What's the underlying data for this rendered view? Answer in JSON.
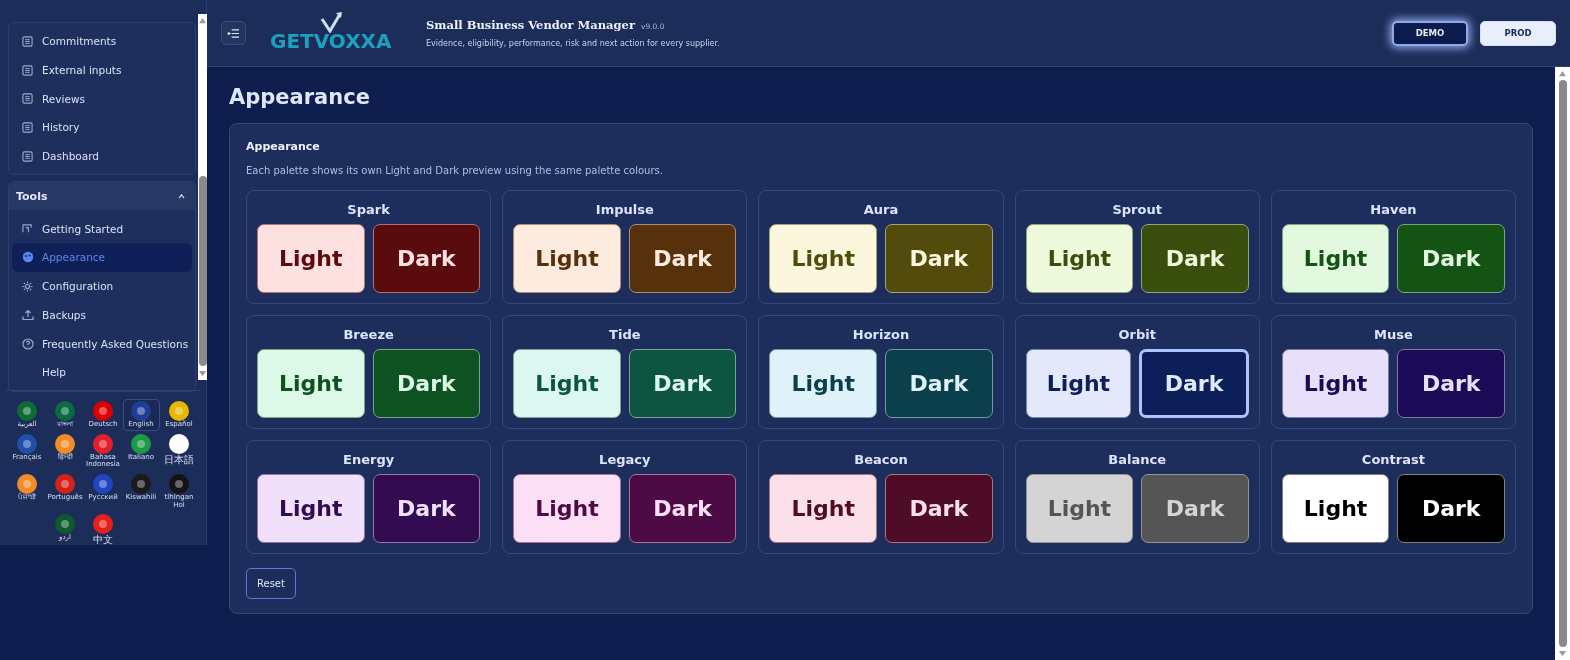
{
  "sidebar": {
    "sections": [
      {
        "items": [
          {
            "label": "Commitments",
            "kind": "doc",
            "selected": false
          },
          {
            "label": "External inputs",
            "kind": "doc",
            "selected": false
          },
          {
            "label": "Reviews",
            "kind": "doc",
            "selected": false
          },
          {
            "label": "History",
            "kind": "doc",
            "selected": false
          },
          {
            "label": "Dashboard",
            "kind": "doc",
            "selected": false
          }
        ]
      },
      {
        "title": "Tools",
        "expanded": true,
        "items": [
          {
            "label": "Getting Started",
            "kind": "guide",
            "selected": false
          },
          {
            "label": "Appearance",
            "kind": "palette",
            "selected": true
          },
          {
            "label": "Configuration",
            "kind": "gear",
            "selected": false
          },
          {
            "label": "Backups",
            "kind": "upload",
            "selected": false
          },
          {
            "label": "Frequently Asked Questions",
            "kind": "help",
            "selected": false
          },
          {
            "label": "Help",
            "kind": "none",
            "selected": false
          }
        ]
      }
    ],
    "languages": [
      {
        "label": "العربية",
        "color": "#0d6b35",
        "selected": false
      },
      {
        "label": "বাংলা",
        "color": "#0a6a42",
        "selected": false
      },
      {
        "label": "Deutsch",
        "color": "#dd0000",
        "selected": false
      },
      {
        "label": "English",
        "color": "#1f3f95",
        "selected": true
      },
      {
        "label": "Español",
        "color": "#e8b800",
        "selected": false
      },
      {
        "label": "Français",
        "color": "#1f4fa8",
        "selected": false
      },
      {
        "label": "हिन्दी",
        "color": "#f28c28",
        "selected": false
      },
      {
        "label": "Bahasa Indonesia",
        "color": "#e0202a",
        "selected": false
      },
      {
        "label": "Italiano",
        "color": "#1d9a48",
        "selected": false
      },
      {
        "label": "日本語",
        "color": "#ffffff",
        "selected": false
      },
      {
        "label": "ਪੰਜਾਬੀ",
        "color": "#f28c28",
        "selected": false
      },
      {
        "label": "Português",
        "color": "#d6201a",
        "selected": false
      },
      {
        "label": "Русский",
        "color": "#1f45c0",
        "selected": false
      },
      {
        "label": "Kiswahili",
        "color": "#1a1a1a",
        "selected": false
      },
      {
        "label": "tlhIngan Hol",
        "color": "#141414",
        "selected": false
      },
      {
        "label": "اردو",
        "color": "#0d5b2c",
        "selected": false
      },
      {
        "label": "中文",
        "color": "#e4201a",
        "selected": false
      }
    ]
  },
  "header": {
    "logo": "GETVOXXA",
    "title": "Small Business Vendor Manager",
    "version": "v9.0.0",
    "subtitle": "Evidence, eligibility, performance, risk and next action for every supplier.",
    "environments": [
      {
        "label": "DEMO",
        "selected": true
      },
      {
        "label": "PROD",
        "selected": false
      }
    ]
  },
  "page": {
    "title": "Appearance",
    "panel_title": "Appearance",
    "description": "Each palette shows its own Light and Dark preview using the same palette colours.",
    "palettes": [
      {
        "name": "Spark",
        "previews": [
          {
            "label": "Light",
            "color": "#fde0e0",
            "selected": false
          },
          {
            "label": "Dark",
            "color": "#5a0b0e",
            "selected": false
          }
        ]
      },
      {
        "name": "Impulse",
        "previews": [
          {
            "label": "Light",
            "color": "#fdebdf",
            "selected": false
          },
          {
            "label": "Dark",
            "color": "#57300c",
            "selected": false
          }
        ]
      },
      {
        "name": "Aura",
        "previews": [
          {
            "label": "Light",
            "color": "#fbf7dc",
            "selected": false
          },
          {
            "label": "Dark",
            "color": "#524b0c",
            "selected": false
          }
        ]
      },
      {
        "name": "Sprout",
        "previews": [
          {
            "label": "Light",
            "color": "#eff9dc",
            "selected": false
          },
          {
            "label": "Dark",
            "color": "#3a4e0e",
            "selected": false
          }
        ]
      },
      {
        "name": "Haven",
        "previews": [
          {
            "label": "Light",
            "color": "#e2f9e0",
            "selected": false
          },
          {
            "label": "Dark",
            "color": "#145313",
            "selected": false
          }
        ]
      },
      {
        "name": "Breeze",
        "previews": [
          {
            "label": "Light",
            "color": "#dcf8e6",
            "selected": false
          },
          {
            "label": "Dark",
            "color": "#0d5220",
            "selected": false
          }
        ]
      },
      {
        "name": "Tide",
        "previews": [
          {
            "label": "Light",
            "color": "#dcf7f0",
            "selected": false
          },
          {
            "label": "Dark",
            "color": "#0d5540",
            "selected": false
          }
        ]
      },
      {
        "name": "Horizon",
        "previews": [
          {
            "label": "Light",
            "color": "#dff2f9",
            "selected": false
          },
          {
            "label": "Dark",
            "color": "#0b3f4c",
            "selected": false
          }
        ]
      },
      {
        "name": "Orbit",
        "previews": [
          {
            "label": "Light",
            "color": "#e3e9fb",
            "selected": false
          },
          {
            "label": "Dark",
            "color": "#0c1f58",
            "selected": true
          }
        ]
      },
      {
        "name": "Muse",
        "previews": [
          {
            "label": "Light",
            "color": "#e6e0fa",
            "selected": false
          },
          {
            "label": "Dark",
            "color": "#1b0a55",
            "selected": false
          }
        ]
      },
      {
        "name": "Energy",
        "previews": [
          {
            "label": "Light",
            "color": "#f0e0fa",
            "selected": false
          },
          {
            "label": "Dark",
            "color": "#330b50",
            "selected": false
          }
        ]
      },
      {
        "name": "Legacy",
        "previews": [
          {
            "label": "Light",
            "color": "#fbe0f5",
            "selected": false
          },
          {
            "label": "Dark",
            "color": "#4d0b45",
            "selected": false
          }
        ]
      },
      {
        "name": "Beacon",
        "previews": [
          {
            "label": "Light",
            "color": "#fbe0ea",
            "selected": false
          },
          {
            "label": "Dark",
            "color": "#4f0c26",
            "selected": false
          }
        ]
      },
      {
        "name": "Balance",
        "previews": [
          {
            "label": "Light",
            "color": "#d4d4d4",
            "selected": false
          },
          {
            "label": "Dark",
            "color": "#555555",
            "selected": false
          }
        ]
      },
      {
        "name": "Contrast",
        "previews": [
          {
            "label": "Light",
            "color": "#ffffff",
            "selected": false
          },
          {
            "label": "Dark",
            "color": "#000000",
            "selected": false
          }
        ]
      }
    ],
    "reset": "Reset"
  }
}
